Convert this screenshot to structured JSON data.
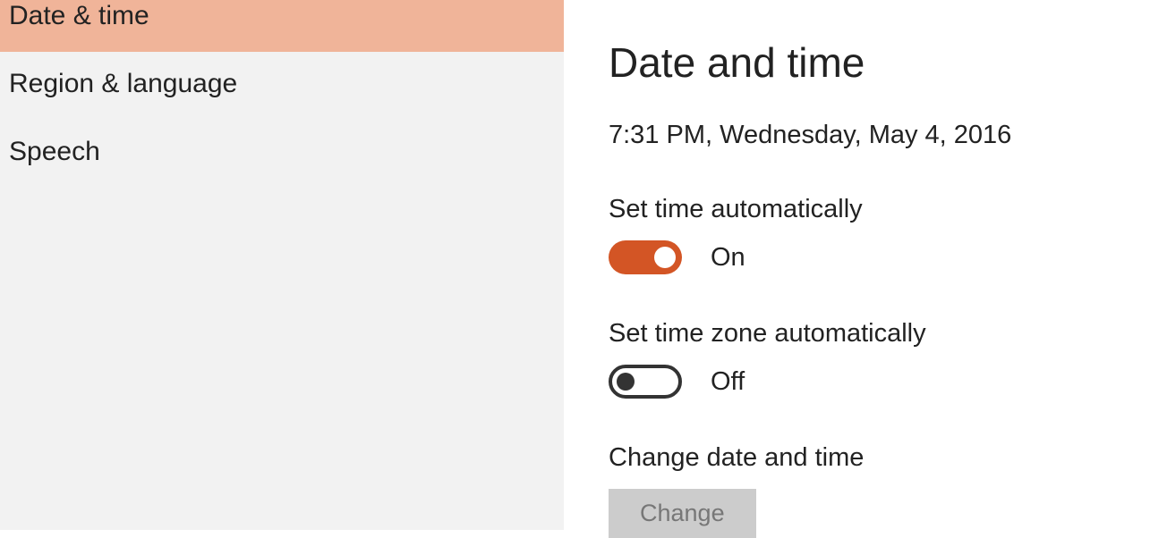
{
  "sidebar": {
    "items": [
      {
        "label": "Date & time",
        "selected": true
      },
      {
        "label": "Region & language",
        "selected": false
      },
      {
        "label": "Speech",
        "selected": false
      }
    ]
  },
  "main": {
    "title": "Date and time",
    "current_datetime": "7:31 PM, Wednesday, May 4, 2016",
    "set_time_auto": {
      "label": "Set time automatically",
      "state": "On",
      "on": true
    },
    "set_timezone_auto": {
      "label": "Set time zone automatically",
      "state": "Off",
      "on": false
    },
    "change_section": {
      "label": "Change date and time",
      "button": "Change"
    }
  }
}
